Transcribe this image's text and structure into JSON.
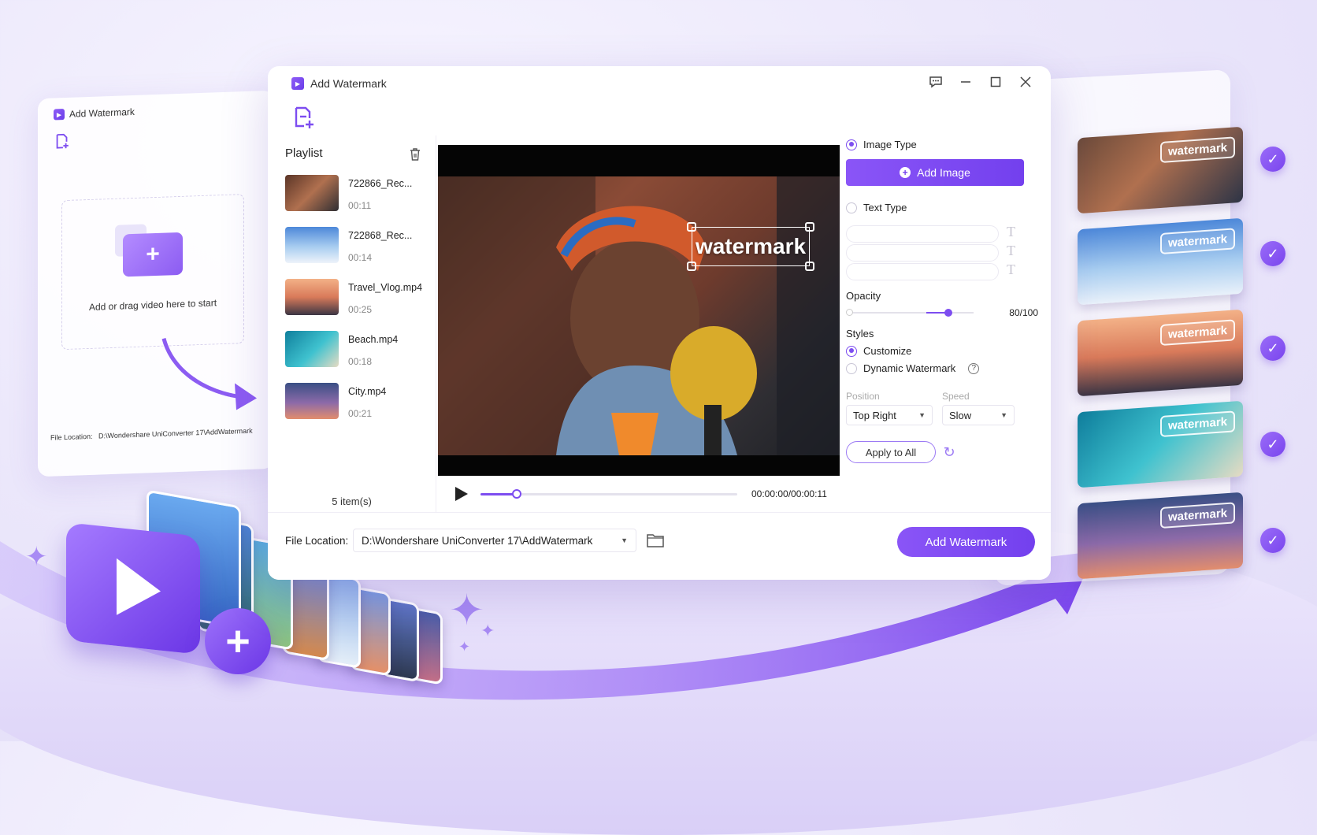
{
  "colors": {
    "accent": "#7d4df0",
    "accent_light": "#9a6cf8",
    "background": "#ece8fb"
  },
  "back_window": {
    "title": "Add Watermark",
    "drop_text": "Add or drag video here to start",
    "file_location_label": "File Location:",
    "file_location_path": "D:\\Wondershare UniConverter 17\\AddWatermark"
  },
  "main_window": {
    "title": "Add Watermark",
    "icons": {
      "feedback": "chat-bubble-icon",
      "minimize": "minimize-icon",
      "maximize": "maximize-icon",
      "close": "close-icon",
      "add_file": "add-file-icon",
      "trash": "trash-icon",
      "folder": "folder-icon",
      "refresh": "refresh-icon"
    }
  },
  "playlist": {
    "title": "Playlist",
    "items": [
      {
        "name": "722866_Rec...",
        "duration": "00:11"
      },
      {
        "name": "722868_Rec...",
        "duration": "00:14"
      },
      {
        "name": "Travel_Vlog.mp4",
        "duration": "00:25"
      },
      {
        "name": "Beach.mp4",
        "duration": "00:18"
      },
      {
        "name": "City.mp4",
        "duration": "00:21"
      }
    ],
    "count": "5 item(s)"
  },
  "preview": {
    "watermark_text": "watermark",
    "time": "00:00:00/00:00:11",
    "progress": 0.14
  },
  "settings": {
    "image_type_label": "Image Type",
    "add_image_label": "Add Image",
    "text_type_label": "Text Type",
    "opacity_label": "Opacity",
    "opacity_value": "80/100",
    "opacity": 0.8,
    "styles_label": "Styles",
    "customize_label": "Customize",
    "dynamic_label": "Dynamic Watermark",
    "position_label": "Position",
    "speed_label": "Speed",
    "position_value": "Top Right",
    "speed_value": "Slow",
    "apply_label": "Apply to All"
  },
  "footer": {
    "file_location_label": "File Location:",
    "file_location_path": "D:\\Wondershare UniConverter 17\\AddWatermark",
    "add_watermark_label": "Add Watermark"
  },
  "outputs": {
    "watermark_label": "watermark",
    "count": 5
  }
}
